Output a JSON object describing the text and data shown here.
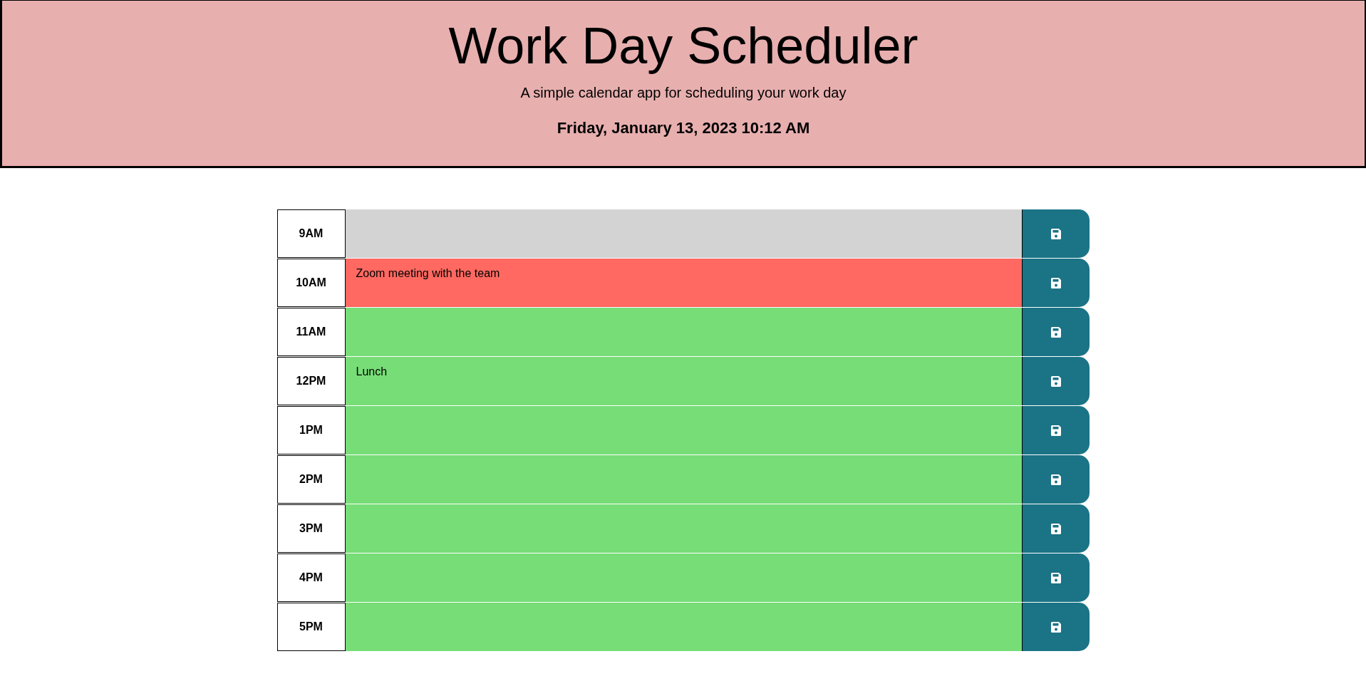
{
  "header": {
    "title": "Work Day Scheduler",
    "subtitle": "A simple calendar app for scheduling your work day",
    "date": "Friday, January 13, 2023 10:12 AM"
  },
  "hours": [
    {
      "label": "9AM",
      "kind": "past"
    },
    {
      "label": "10AM",
      "kind": "present",
      "event": "Zoom meeting with the team"
    },
    {
      "label": "11AM",
      "kind": "future"
    },
    {
      "label": "12PM",
      "kind": "future",
      "event": "Lunch"
    },
    {
      "label": "1PM",
      "kind": "future"
    },
    {
      "label": "2PM",
      "kind": "future"
    },
    {
      "label": "3PM",
      "kind": "future"
    },
    {
      "label": "4PM",
      "kind": "future"
    },
    {
      "label": "5PM",
      "kind": "future"
    }
  ]
}
